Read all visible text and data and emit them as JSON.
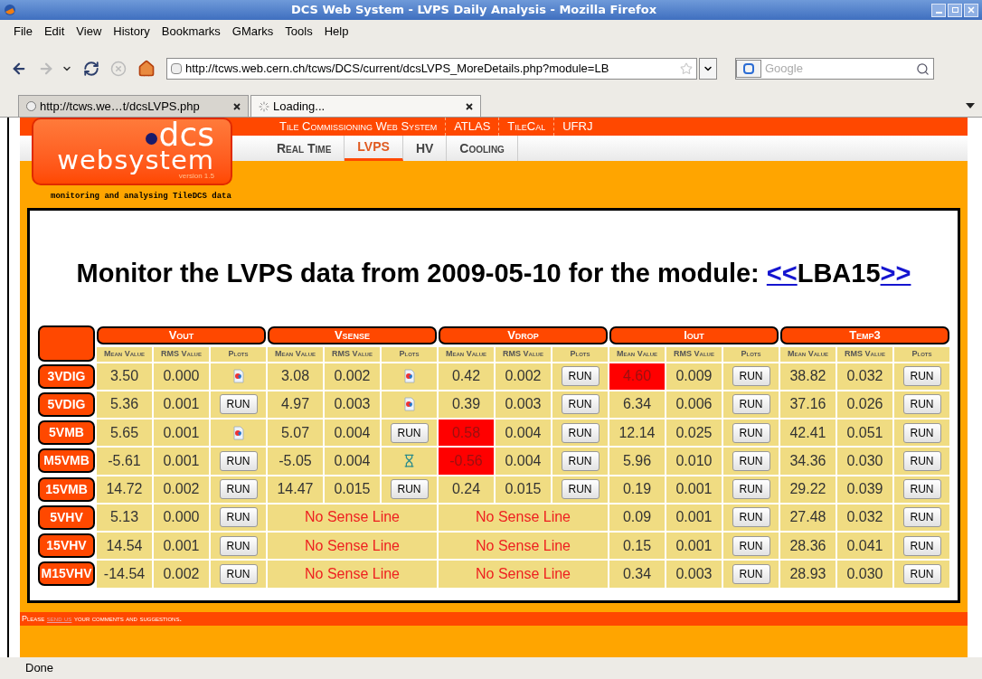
{
  "window": {
    "title": "DCS Web System - LVPS Daily Analysis - Mozilla Firefox"
  },
  "menu": [
    "File",
    "Edit",
    "View",
    "History",
    "Bookmarks",
    "GMarks",
    "Tools",
    "Help"
  ],
  "address_bar": {
    "value": "http://tcws.web.cern.ch/tcws/DCS/current/dcsLVPS_MoreDetails.php?module=LB"
  },
  "search": {
    "placeholder": "Google"
  },
  "tabs": [
    {
      "label": "http://tcws.we…t/dcsLVPS.php",
      "selected": false,
      "loading": false
    },
    {
      "label": "Loading...",
      "selected": true,
      "loading": true
    }
  ],
  "site": {
    "logo_top": "dcs",
    "logo_bottom": "websystem",
    "logo_version": "version 1.5",
    "tagline": "monitoring and analysing TileDCS data",
    "top_links": [
      "Tile Commissioning Web System",
      "ATLAS",
      "TileCal",
      "UFRJ"
    ],
    "nav": [
      {
        "label": "Real Time",
        "selected": false
      },
      {
        "label": "LVPS",
        "selected": true
      },
      {
        "label": "HV",
        "selected": false
      },
      {
        "label": "Cooling",
        "selected": false
      }
    ]
  },
  "heading": {
    "text": "Monitor the LVPS data from 2009-05-10 for the module: ",
    "prev": "<<",
    "module": "LBA15",
    "next": ">>"
  },
  "table": {
    "groups": [
      {
        "name": "Vout",
        "columns": [
          "Mean Value",
          "RMS Value",
          "Plots"
        ]
      },
      {
        "name": "Vsense",
        "columns": [
          "Mean Value",
          "RMS Value",
          "Plots"
        ]
      },
      {
        "name": "Vdrop",
        "columns": [
          "Mean Value",
          "RMS Value",
          "Plots"
        ]
      },
      {
        "name": "Iout",
        "columns": [
          "Mean Value",
          "RMS Value",
          "Plots"
        ]
      },
      {
        "name": "Temp3",
        "columns": [
          "Mean Value",
          "RMS Value",
          "Plots"
        ]
      }
    ],
    "rows": [
      {
        "label": "3VDIG",
        "cells": [
          {
            "kind": "values",
            "mean": "3.50",
            "rms": "0.000",
            "alarm": false,
            "plot": {
              "kind": "image"
            }
          },
          {
            "kind": "values",
            "mean": "3.08",
            "rms": "0.002",
            "alarm": false,
            "plot": {
              "kind": "image"
            }
          },
          {
            "kind": "values",
            "mean": "0.42",
            "rms": "0.002",
            "alarm": false,
            "plot": {
              "kind": "button",
              "label": "RUN"
            }
          },
          {
            "kind": "values",
            "mean": "4.60",
            "rms": "0.009",
            "alarm": true,
            "plot": {
              "kind": "button",
              "label": "RUN"
            }
          },
          {
            "kind": "values",
            "mean": "38.82",
            "rms": "0.032",
            "alarm": false,
            "plot": {
              "kind": "button",
              "label": "RUN"
            }
          }
        ]
      },
      {
        "label": "5VDIG",
        "cells": [
          {
            "kind": "values",
            "mean": "5.36",
            "rms": "0.001",
            "alarm": false,
            "plot": {
              "kind": "button",
              "label": "RUN"
            }
          },
          {
            "kind": "values",
            "mean": "4.97",
            "rms": "0.003",
            "alarm": false,
            "plot": {
              "kind": "image"
            }
          },
          {
            "kind": "values",
            "mean": "0.39",
            "rms": "0.003",
            "alarm": false,
            "plot": {
              "kind": "button",
              "label": "RUN"
            }
          },
          {
            "kind": "values",
            "mean": "6.34",
            "rms": "0.006",
            "alarm": false,
            "plot": {
              "kind": "button",
              "label": "RUN"
            }
          },
          {
            "kind": "values",
            "mean": "37.16",
            "rms": "0.026",
            "alarm": false,
            "plot": {
              "kind": "button",
              "label": "RUN"
            }
          }
        ]
      },
      {
        "label": "5VMB",
        "cells": [
          {
            "kind": "values",
            "mean": "5.65",
            "rms": "0.001",
            "alarm": false,
            "plot": {
              "kind": "image"
            }
          },
          {
            "kind": "values",
            "mean": "5.07",
            "rms": "0.004",
            "alarm": false,
            "plot": {
              "kind": "button",
              "label": "RUN"
            }
          },
          {
            "kind": "values",
            "mean": "0.58",
            "rms": "0.004",
            "alarm": true,
            "plot": {
              "kind": "button",
              "label": "RUN"
            }
          },
          {
            "kind": "values",
            "mean": "12.14",
            "rms": "0.025",
            "alarm": false,
            "plot": {
              "kind": "button",
              "label": "RUN"
            }
          },
          {
            "kind": "values",
            "mean": "42.41",
            "rms": "0.051",
            "alarm": false,
            "plot": {
              "kind": "button",
              "label": "RUN"
            }
          }
        ]
      },
      {
        "label": "M5VMB",
        "cells": [
          {
            "kind": "values",
            "mean": "-5.61",
            "rms": "0.001",
            "alarm": false,
            "plot": {
              "kind": "button",
              "label": "RUN"
            }
          },
          {
            "kind": "values",
            "mean": "-5.05",
            "rms": "0.004",
            "alarm": false,
            "plot": {
              "kind": "hourglass"
            }
          },
          {
            "kind": "values",
            "mean": "-0.56",
            "rms": "0.004",
            "alarm": true,
            "plot": {
              "kind": "button",
              "label": "RUN"
            }
          },
          {
            "kind": "values",
            "mean": "5.96",
            "rms": "0.010",
            "alarm": false,
            "plot": {
              "kind": "button",
              "label": "RUN"
            }
          },
          {
            "kind": "values",
            "mean": "34.36",
            "rms": "0.030",
            "alarm": false,
            "plot": {
              "kind": "button",
              "label": "RUN"
            }
          }
        ]
      },
      {
        "label": "15VMB",
        "cells": [
          {
            "kind": "values",
            "mean": "14.72",
            "rms": "0.002",
            "alarm": false,
            "plot": {
              "kind": "button",
              "label": "RUN"
            }
          },
          {
            "kind": "values",
            "mean": "14.47",
            "rms": "0.015",
            "alarm": false,
            "plot": {
              "kind": "button",
              "label": "RUN"
            }
          },
          {
            "kind": "values",
            "mean": "0.24",
            "rms": "0.015",
            "alarm": false,
            "plot": {
              "kind": "button",
              "label": "RUN"
            }
          },
          {
            "kind": "values",
            "mean": "0.19",
            "rms": "0.001",
            "alarm": false,
            "plot": {
              "kind": "button",
              "label": "RUN"
            }
          },
          {
            "kind": "values",
            "mean": "29.22",
            "rms": "0.039",
            "alarm": false,
            "plot": {
              "kind": "button",
              "label": "RUN"
            }
          }
        ]
      },
      {
        "label": "5VHV",
        "cells": [
          {
            "kind": "values",
            "mean": "5.13",
            "rms": "0.000",
            "alarm": false,
            "plot": {
              "kind": "button",
              "label": "RUN"
            }
          },
          {
            "kind": "no_sense",
            "text": "No Sense Line"
          },
          {
            "kind": "no_sense",
            "text": "No Sense Line"
          },
          {
            "kind": "values",
            "mean": "0.09",
            "rms": "0.001",
            "alarm": false,
            "plot": {
              "kind": "button",
              "label": "RUN"
            }
          },
          {
            "kind": "values",
            "mean": "27.48",
            "rms": "0.032",
            "alarm": false,
            "plot": {
              "kind": "button",
              "label": "RUN"
            }
          }
        ]
      },
      {
        "label": "15VHV",
        "cells": [
          {
            "kind": "values",
            "mean": "14.54",
            "rms": "0.001",
            "alarm": false,
            "plot": {
              "kind": "button",
              "label": "RUN"
            }
          },
          {
            "kind": "no_sense",
            "text": "No Sense Line"
          },
          {
            "kind": "no_sense",
            "text": "No Sense Line"
          },
          {
            "kind": "values",
            "mean": "0.15",
            "rms": "0.001",
            "alarm": false,
            "plot": {
              "kind": "button",
              "label": "RUN"
            }
          },
          {
            "kind": "values",
            "mean": "28.36",
            "rms": "0.041",
            "alarm": false,
            "plot": {
              "kind": "button",
              "label": "RUN"
            }
          }
        ]
      },
      {
        "label": "M15VHV",
        "cells": [
          {
            "kind": "values",
            "mean": "-14.54",
            "rms": "0.002",
            "alarm": false,
            "plot": {
              "kind": "button",
              "label": "RUN"
            }
          },
          {
            "kind": "no_sense",
            "text": "No Sense Line"
          },
          {
            "kind": "no_sense",
            "text": "No Sense Line"
          },
          {
            "kind": "values",
            "mean": "0.34",
            "rms": "0.003",
            "alarm": false,
            "plot": {
              "kind": "button",
              "label": "RUN"
            }
          },
          {
            "kind": "values",
            "mean": "28.93",
            "rms": "0.030",
            "alarm": false,
            "plot": {
              "kind": "button",
              "label": "RUN"
            }
          }
        ]
      }
    ]
  },
  "footer": {
    "before": "Please ",
    "link": "send us",
    "after": " your comments and suggestions."
  },
  "status_bar": "Done"
}
